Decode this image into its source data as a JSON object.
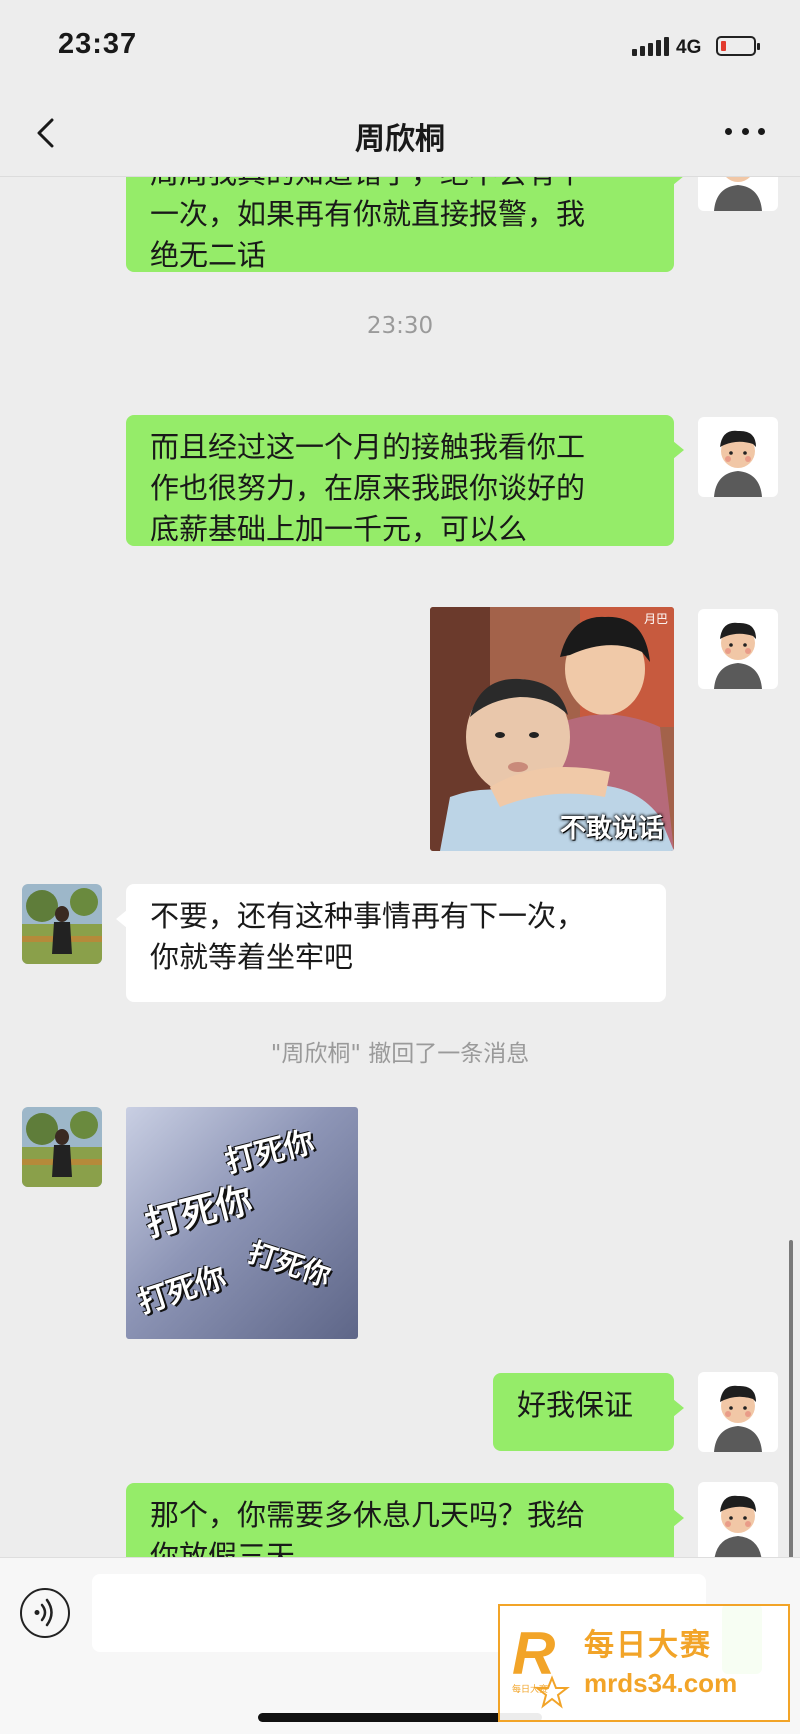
{
  "status_bar": {
    "time": "23:37",
    "network": "4G"
  },
  "header": {
    "title": "周欣桐"
  },
  "messages": {
    "m1": {
      "line1": "周周我真的知道错了，绝不会有下",
      "line2": "一次，如果再有你就直接报警，我",
      "line3": "绝无二话"
    },
    "timestamp": "23:30",
    "m2": {
      "line1": "而且经过这一个月的接触我看你工",
      "line2": "作也很努力，在原来我跟你谈好的",
      "line3": "底薪基础上加一千元，可以么"
    },
    "sticker1": {
      "caption": "不敢说话",
      "corner_tag": "月巴"
    },
    "m3": {
      "line1": "不要，还有这种事情再有下一次，",
      "line2": "你就等着坐牢吧"
    },
    "recall_notice": "\"周欣桐\" 撤回了一条消息",
    "sticker2": {
      "text": "打死你"
    },
    "m4": {
      "line1": "好我保证"
    },
    "m5": {
      "line1": "那个，你需要多休息几天吗？我给",
      "line2": "你放假三天"
    }
  },
  "watermark": {
    "title": "每日大赛",
    "url": "mrds34.com",
    "logo_text": "每日大赛"
  },
  "colors": {
    "green_bubble": "#95ec69",
    "white_bubble": "#ffffff",
    "background": "#ededed",
    "watermark": "#f2a428"
  },
  "icons": [
    "back-icon",
    "more-icon",
    "voice-icon",
    "battery-icon",
    "signal-icon"
  ]
}
